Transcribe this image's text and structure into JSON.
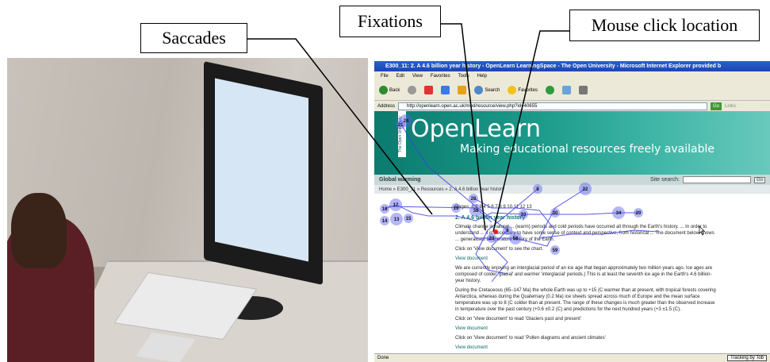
{
  "annotations": {
    "saccades": "Saccades",
    "fixations": "Fixations",
    "mouse_click": "Mouse click location"
  },
  "browser": {
    "title": "E300_11: 2. A 4.6 billion year history - OpenLearn LearningSpace - The Open University - Microsoft Internet Explorer provided b",
    "menu": [
      "File",
      "Edit",
      "View",
      "Favorites",
      "Tools",
      "Help"
    ],
    "toolbar": {
      "back": "Back",
      "search": "Search",
      "favorites": "Favorites"
    },
    "address_label": "Address",
    "address": "http://openlearn.open.ac.uk/mod/resource/view.php?id=40655",
    "go": "Go",
    "links": "Links",
    "status_left": "Done",
    "tracking": "Tracking by Tob"
  },
  "site": {
    "title": "OpenLearn",
    "subtitle": "Making educational resources freely available",
    "ou_label": "The Open University",
    "course": "Global warming",
    "site_search_label": "Site search:",
    "site_search_go": "Go",
    "breadcrumb": "Home » E300_11 » Resources » 2. A 4.6 billion year history"
  },
  "content": {
    "pages": "Pages: 1 2 3 4 5 6 7 8 9 10 11 12 13",
    "heading": "2. A 4.6 billion year history",
    "p1": "Climate change is natural ... (warm) periods and cold periods have occurred all through the Earth's history. ... In order to understand ... it is necessary to have some sense of context and perspective, from historical ... The document below shows ... generalised temperature history of the Earth.",
    "click1": "Click on 'View document' to see the chart.",
    "view1": "View document",
    "p2": "We are currently enjoying an interglacial period of an ice age that began approximately two million years ago. Ice ages are composed of colder 'glacial' and warmer 'interglacial' periods.) This is at least the seventh ice age in the Earth's 4.6 billion-year history.",
    "p3": "During the Cretaceous (65–147 Ma) the whole Earth was up to +15 (C warmer than at present, with tropical forests covering Antarctica, whereas during the Quaternary (0.2 Ma) ice sheets spread across much of Europe and the mean surface temperature was up to 8 (C colder than at present. The range of these changes is much greater than the observed increase in temperature over the past century (+0.6 ±0.2 (C) and predictions for the next hundred years (+3 ±1.5 (C).",
    "click2": "Click on 'View document' to read 'Glaciers past and present'",
    "view2": "View document",
    "click3": "Click on 'View document' to read 'Pollen diagrams and ancient climates'",
    "view3": "View document"
  },
  "fixation_labels": [
    "17",
    "18",
    "14",
    "13",
    "15",
    "21",
    "24",
    "20",
    "19",
    "22",
    "8",
    "6",
    "58",
    "59",
    "23",
    "38",
    "33",
    "30",
    "34",
    "29"
  ],
  "colors": {
    "fixation": "#5a5ef0",
    "click": "#e02020",
    "accent": "#0a7a6c"
  }
}
